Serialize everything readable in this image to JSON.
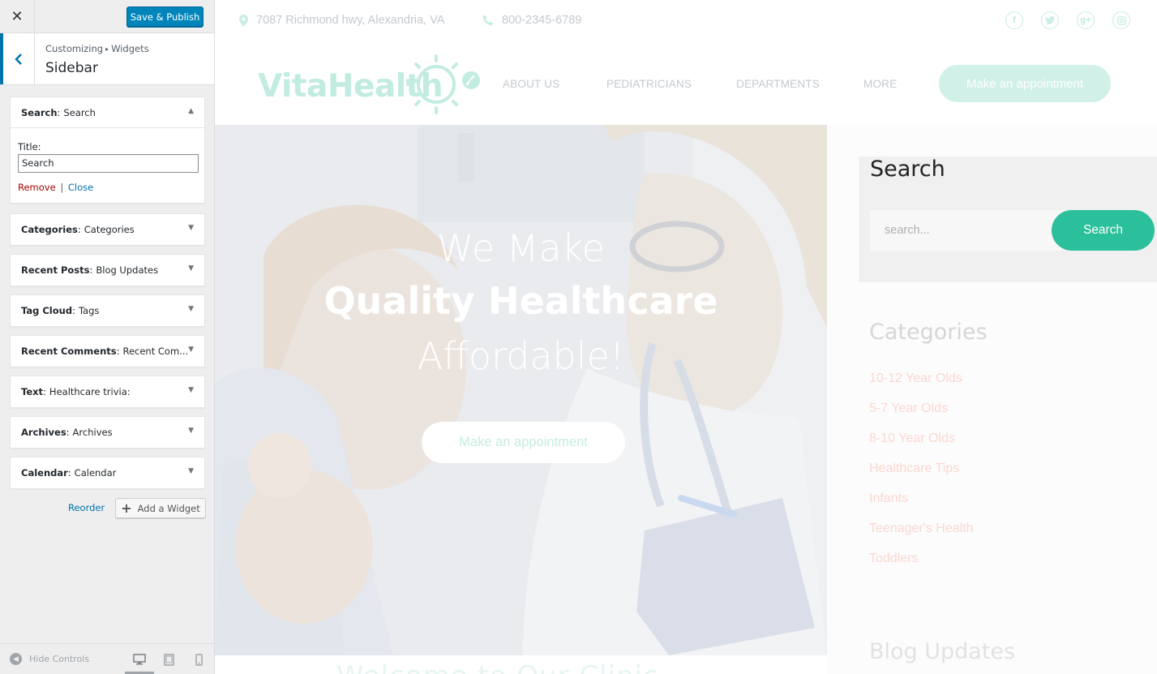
{
  "customizer": {
    "close_glyph": "✕",
    "save_label": "Save & Publish",
    "breadcrumb": {
      "root": "Customizing",
      "sep": "▸",
      "current": "Widgets"
    },
    "section_title": "Sidebar",
    "widgets": [
      {
        "type": "Search",
        "name": "Search",
        "expanded": true
      },
      {
        "type": "Categories",
        "name": "Categories"
      },
      {
        "type": "Recent Posts",
        "name": "Blog Updates"
      },
      {
        "type": "Tag Cloud",
        "name": "Tags"
      },
      {
        "type": "Recent Comments",
        "name": "Recent Com..."
      },
      {
        "type": "Text",
        "name": "Healthcare trivia:"
      },
      {
        "type": "Archives",
        "name": "Archives"
      },
      {
        "type": "Calendar",
        "name": "Calendar"
      }
    ],
    "expanded_widget": {
      "title_label": "Title:",
      "title_value": "Search",
      "remove_label": "Remove",
      "pipe": "|",
      "close_label": "Close"
    },
    "reorder_label": "Reorder",
    "add_widget_label": "Add a Widget",
    "hide_controls_label": "Hide Controls",
    "active_device": "desktop"
  },
  "site": {
    "address": "7087 Richmond hwy, Alexandria, VA",
    "phone": "800-2345-6789",
    "social": [
      "facebook-icon",
      "twitter-icon",
      "google-plus-icon",
      "instagram-icon"
    ],
    "logo_text": "VitaHealth",
    "nav": [
      "ABOUT US",
      "PEDIATRICIANS",
      "DEPARTMENTS",
      "MORE"
    ],
    "appointment_label": "Make an appointment",
    "hero": {
      "line1": "We Make",
      "line2": "Quality Healthcare",
      "line3": "Affordable!",
      "button": "Make an appointment"
    },
    "sidebar": {
      "search_title": "Search",
      "search_placeholder": "search...",
      "search_button": "Search",
      "categories_title": "Categories",
      "categories": [
        "10-12 Year Olds",
        "5-7 Year Olds",
        "8-10 Year Olds",
        "Healthcare Tips",
        "Infants",
        "Teenager's Health",
        "Toddlers"
      ],
      "blog_title": "Blog Updates"
    },
    "below_hero_text": "Welcome to Our Clinic"
  },
  "colors": {
    "wp_blue": "#0085ba",
    "accent_green": "#2bbf9b",
    "category_link": "#fbd7d0"
  }
}
